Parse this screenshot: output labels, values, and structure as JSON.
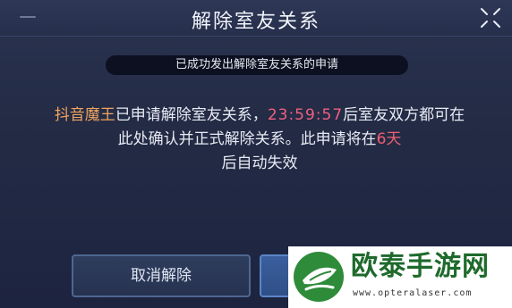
{
  "dialog": {
    "title": "解除室友关系",
    "notice": "已成功发出解除室友关系的申请",
    "message": {
      "player_name": "抖音魔王",
      "text_1": "已申请解除室友关系，",
      "countdown": "23:59:57",
      "text_2": "后室友双方都可在此处确认并正式解除关系。此申请将在",
      "days": "6天",
      "text_3": "后自动失效"
    },
    "buttons": {
      "cancel_label": "取消解除"
    }
  },
  "watermark": {
    "text": "欧泰手游网",
    "url": "www.opteralaser.com"
  },
  "colors": {
    "name": "#f0a35e",
    "countdown": "#f06080",
    "days": "#f06070",
    "watermark_green": "#1e6a2c"
  }
}
